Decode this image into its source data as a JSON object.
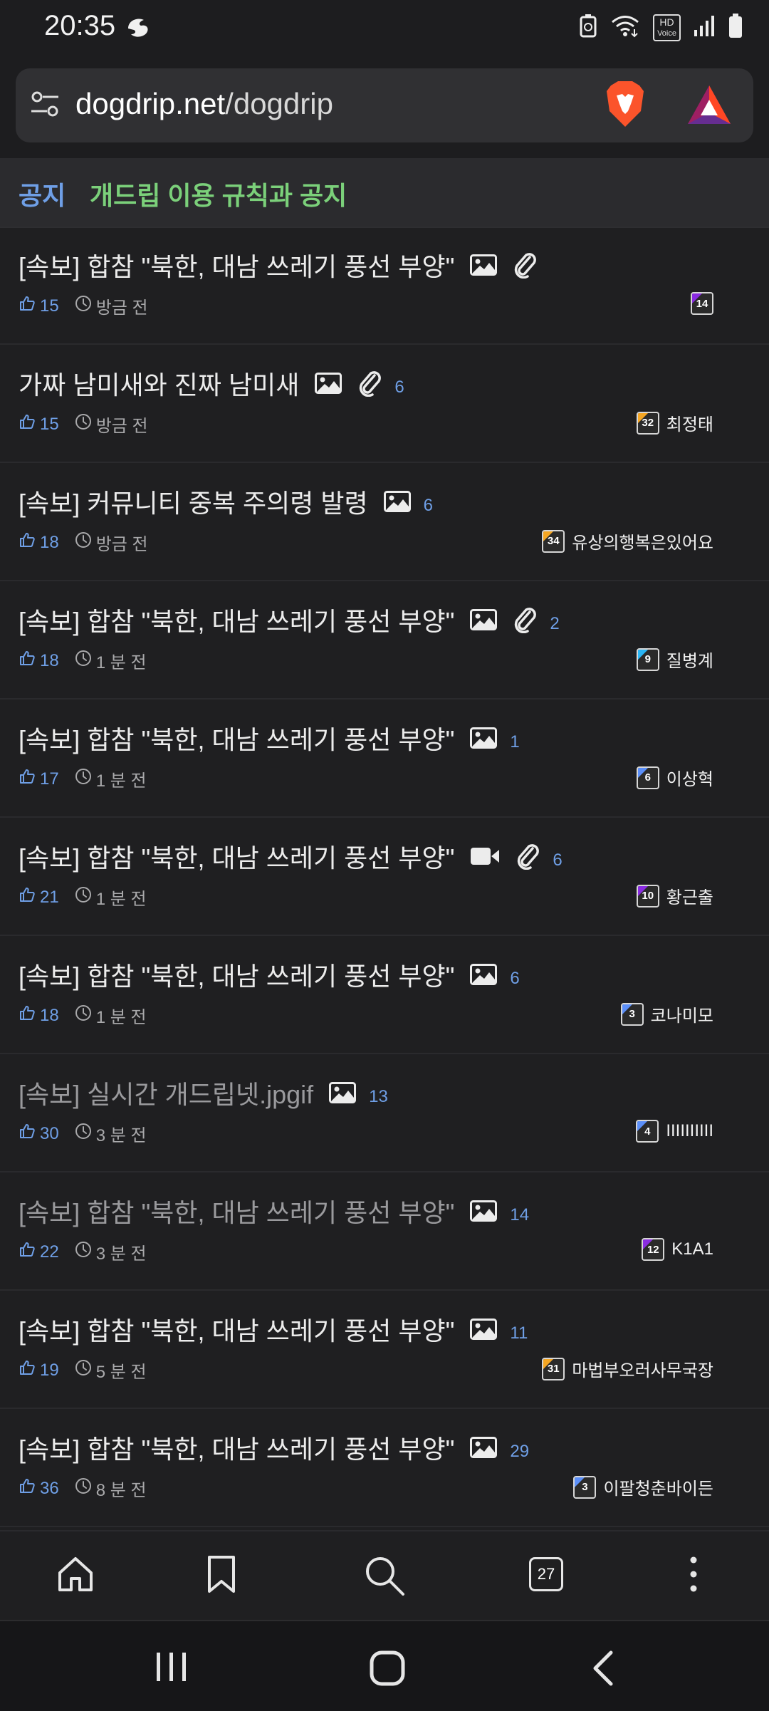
{
  "status_bar": {
    "time": "20:35",
    "hd_badge_top": "HD",
    "hd_badge_bottom": "Voice",
    "icons": [
      "assistant-icon",
      "recycle-icon",
      "wifi-icon",
      "hd-voice-icon",
      "signal-icon",
      "battery-icon"
    ]
  },
  "browser": {
    "url_domain": "dogdrip.net",
    "url_path": "/dogdrip",
    "icons": [
      "tune-icon",
      "brave-shield-icon",
      "bat-rewards-icon"
    ]
  },
  "notice": {
    "label": "공지",
    "text": "개드립 이용 규칙과 공지"
  },
  "posts": [
    {
      "title": "[속보] 합참 \"북한, 대남 쓰레기 풍선 부양\"",
      "image": true,
      "attach": true,
      "video": false,
      "comments": "",
      "likes": "15",
      "time": "방금 전",
      "level": "14",
      "level_color": "#8a2be2",
      "author": "",
      "read": false
    },
    {
      "title": "가짜 남미새와 진짜 남미새",
      "image": true,
      "attach": true,
      "video": false,
      "comments": "6",
      "likes": "15",
      "time": "방금 전",
      "level": "32",
      "level_color": "#f5a623",
      "author": "최정태",
      "read": false
    },
    {
      "title": "[속보] 커뮤니티 중복 주의령 발령",
      "image": true,
      "attach": false,
      "video": false,
      "comments": "6",
      "likes": "18",
      "time": "방금 전",
      "level": "34",
      "level_color": "#f5a623",
      "author": "유상의행복은있어요",
      "read": false
    },
    {
      "title": "[속보] 합참 \"북한, 대남 쓰레기 풍선 부양\"",
      "image": true,
      "attach": true,
      "video": false,
      "comments": "2",
      "likes": "18",
      "time": "1 분 전",
      "level": "9",
      "level_color": "#29b6f6",
      "author": "질병계",
      "read": false
    },
    {
      "title": "[속보] 합참 \"북한, 대남 쓰레기 풍선 부양\"",
      "image": true,
      "attach": false,
      "video": false,
      "comments": "1",
      "likes": "17",
      "time": "1 분 전",
      "level": "6",
      "level_color": "#5b8ff9",
      "author": "이상혁",
      "read": false
    },
    {
      "title": "[속보] 합참 \"북한, 대남 쓰레기 풍선 부양\"",
      "image": false,
      "attach": true,
      "video": true,
      "comments": "6",
      "likes": "21",
      "time": "1 분 전",
      "level": "10",
      "level_color": "#8a2be2",
      "author": "황근출",
      "read": false
    },
    {
      "title": "[속보] 합참 \"북한, 대남 쓰레기 풍선 부양\"",
      "image": true,
      "attach": false,
      "video": false,
      "comments": "6",
      "likes": "18",
      "time": "1 분 전",
      "level": "3",
      "level_color": "#5b8ff9",
      "author": "코나미모",
      "read": false
    },
    {
      "title": "[속보] 실시간 개드립넷.jpgif",
      "image": true,
      "attach": false,
      "video": false,
      "comments": "13",
      "likes": "30",
      "time": "3 분 전",
      "level": "4",
      "level_color": "#5b8ff9",
      "author": "IIIIIIIIII",
      "read": true
    },
    {
      "title": "[속보] 합참 \"북한, 대남 쓰레기 풍선 부양\"",
      "image": true,
      "attach": false,
      "video": false,
      "comments": "14",
      "likes": "22",
      "time": "3 분 전",
      "level": "12",
      "level_color": "#8a2be2",
      "author": "K1A1",
      "read": true
    },
    {
      "title": "[속보] 합참 \"북한, 대남 쓰레기 풍선 부양\"",
      "image": true,
      "attach": false,
      "video": false,
      "comments": "11",
      "likes": "19",
      "time": "5 분 전",
      "level": "31",
      "level_color": "#f5a623",
      "author": "마법부오러사무국장",
      "read": false
    },
    {
      "title": "[속보] 합참 \"북한, 대남 쓰레기 풍선 부양\"",
      "image": true,
      "attach": false,
      "video": false,
      "comments": "29",
      "likes": "36",
      "time": "8 분 전",
      "level": "3",
      "level_color": "#5b8ff9",
      "author": "이팔청춘바이든",
      "read": false
    }
  ],
  "toolbar": {
    "tab_count": "27",
    "icons": [
      "home-icon",
      "bookmark-icon",
      "search-icon",
      "tabs-icon",
      "more-icon"
    ]
  },
  "navbar": {
    "icons": [
      "recent-apps-icon",
      "home-nav-icon",
      "back-icon"
    ]
  }
}
